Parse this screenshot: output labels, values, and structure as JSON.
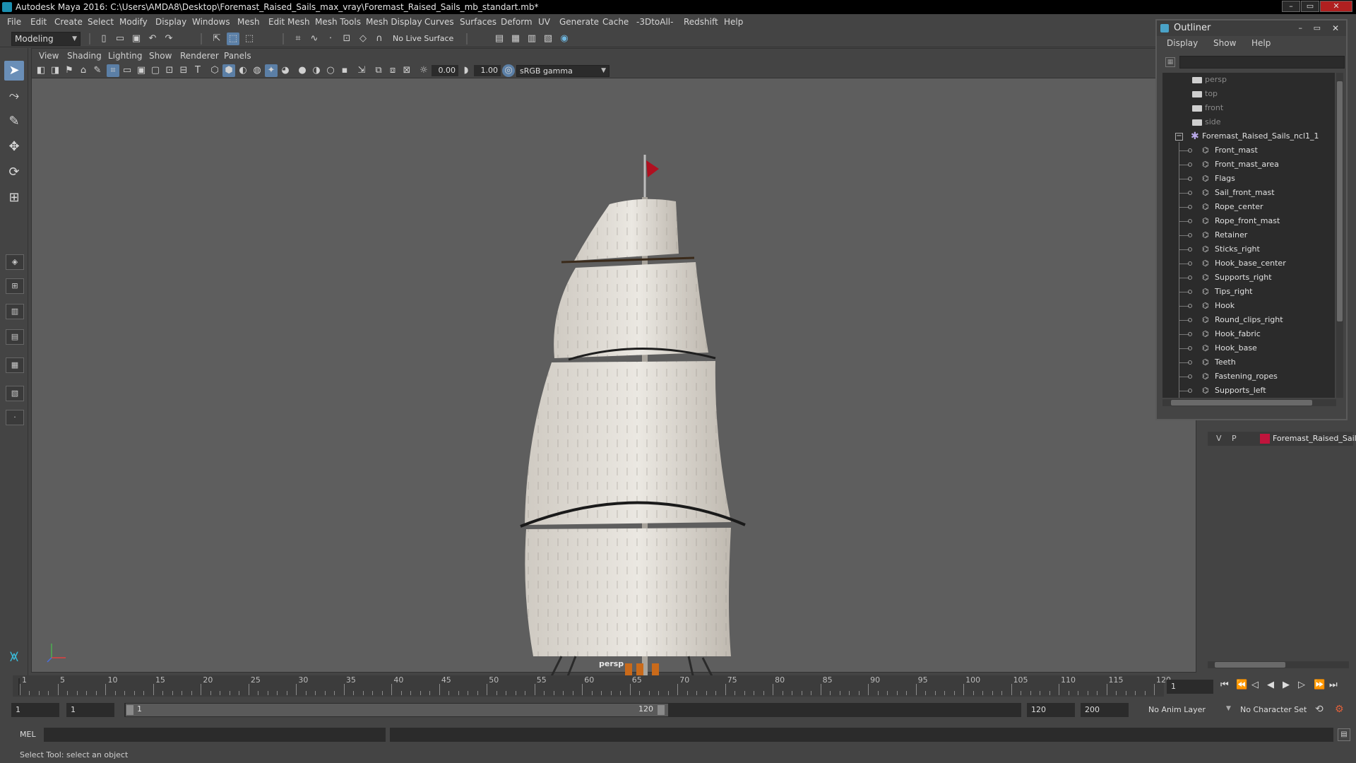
{
  "window": {
    "title": "Autodesk Maya 2016: C:\\Users\\AMDA8\\Desktop\\Foremast_Raised_Sails_max_vray\\Foremast_Raised_Sails_mb_standart.mb*"
  },
  "menubar": [
    "File",
    "Edit",
    "Create",
    "Select",
    "Modify",
    "Display",
    "Windows",
    "Mesh",
    "Edit Mesh",
    "Mesh Tools",
    "Mesh Display",
    "Curves",
    "Surfaces",
    "Deform",
    "UV",
    "Generate",
    "Cache",
    "-3DtoAll-",
    "Redshift",
    "Help"
  ],
  "statusline": {
    "mode": "Modeling",
    "live_surface": "No Live Surface"
  },
  "panel": {
    "menus": [
      "View",
      "Shading",
      "Lighting",
      "Show",
      "Renderer",
      "Panels"
    ],
    "exposure": "0.00",
    "gamma": "1.00",
    "color_space": "sRGB gamma",
    "camera_label": "persp"
  },
  "outliner": {
    "title": "Outliner",
    "menus": [
      "Display",
      "Show",
      "Help"
    ],
    "cameras": [
      "persp",
      "top",
      "front",
      "side"
    ],
    "group": "Foremast_Raised_Sails_ncl1_1",
    "children": [
      "Front_mast",
      "Front_mast_area",
      "Flags",
      "Sail_front_mast",
      "Rope_center",
      "Rope_front_mast",
      "Retainer",
      "Sticks_right",
      "Hook_base_center",
      "Supports_right",
      "Tips_right",
      "Hook",
      "Round_clips_right",
      "Hook_fabric",
      "Hook_base",
      "Teeth",
      "Fastening_ropes",
      "Supports_left"
    ]
  },
  "layers": {
    "v": "V",
    "p": "P",
    "name": "Foremast_Raised_Sails",
    "color": "#c0143c"
  },
  "timeline": {
    "ticks": [
      1,
      5,
      10,
      15,
      20,
      25,
      30,
      35,
      40,
      45,
      50,
      55,
      60,
      65,
      70,
      75,
      80,
      85,
      90,
      95,
      100,
      105,
      110,
      115,
      120
    ],
    "current_frame": "1"
  },
  "range": {
    "start": "1",
    "playback_start": "1",
    "range_start_label": "1",
    "range_end_label": "120",
    "playback_end": "120",
    "end": "200",
    "anim_layer": "No Anim Layer",
    "character_set": "No Character Set"
  },
  "command": {
    "lang": "MEL",
    "help": "Select Tool: select an object"
  },
  "colors": {
    "accent": "#5b7fa6",
    "viewport_bg": "#5e5e5e",
    "flag": "#b01020"
  }
}
